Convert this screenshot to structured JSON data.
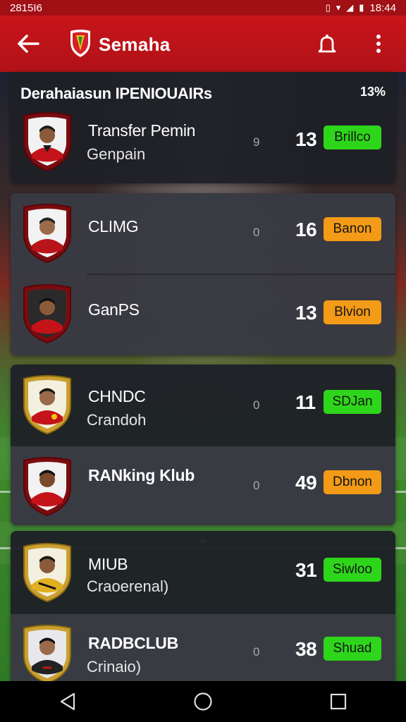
{
  "status_bar": {
    "time_left": "2815I6",
    "time_right": "18:44"
  },
  "app_bar": {
    "title": "Semaha"
  },
  "colors": {
    "primary_red": "#c8151b",
    "badge_green": "#2ed61b",
    "badge_orange": "#f39a16"
  },
  "header_card": {
    "title": "Derahaiasun IPENIOUAIRs",
    "percent": "13%",
    "player": {
      "name": "Transfer Pemin",
      "sub": "Genpain",
      "zero": "9",
      "score": "13",
      "badge": "Brillco",
      "badge_color": "green"
    }
  },
  "card2": [
    {
      "name": "CLIMG",
      "sub": "",
      "zero": "0",
      "score": "16",
      "badge": "Banon",
      "badge_color": "orange"
    },
    {
      "name": "GanPS",
      "sub": "",
      "zero": "",
      "score": "13",
      "badge": "Blvion",
      "badge_color": "orange"
    }
  ],
  "card3": [
    {
      "name": "CHNDC",
      "sub": "Crandoh",
      "zero": "0",
      "score": "11",
      "badge": "SDJan",
      "badge_color": "green"
    },
    {
      "name": "RANking Klub",
      "sub": "",
      "zero": "0",
      "score": "49",
      "badge": "Dbnon",
      "badge_color": "orange"
    }
  ],
  "card4": [
    {
      "name": "MIUB",
      "sub": "Craoerenal)",
      "zero": "",
      "score": "31",
      "badge": "Siwloo",
      "badge_color": "green"
    },
    {
      "name": "RADBCLUB",
      "sub": "Crinaio)",
      "zero": "0",
      "score": "38",
      "badge": "Shuad",
      "badge_color": "green"
    }
  ],
  "icons": {
    "back": "arrow-left-icon",
    "logo": "club-shield-logo",
    "notifications": "bell-icon",
    "menu": "more-vert-icon",
    "nav_back": "triangle-back-icon",
    "nav_home": "circle-home-icon",
    "nav_recents": "square-recents-icon"
  }
}
